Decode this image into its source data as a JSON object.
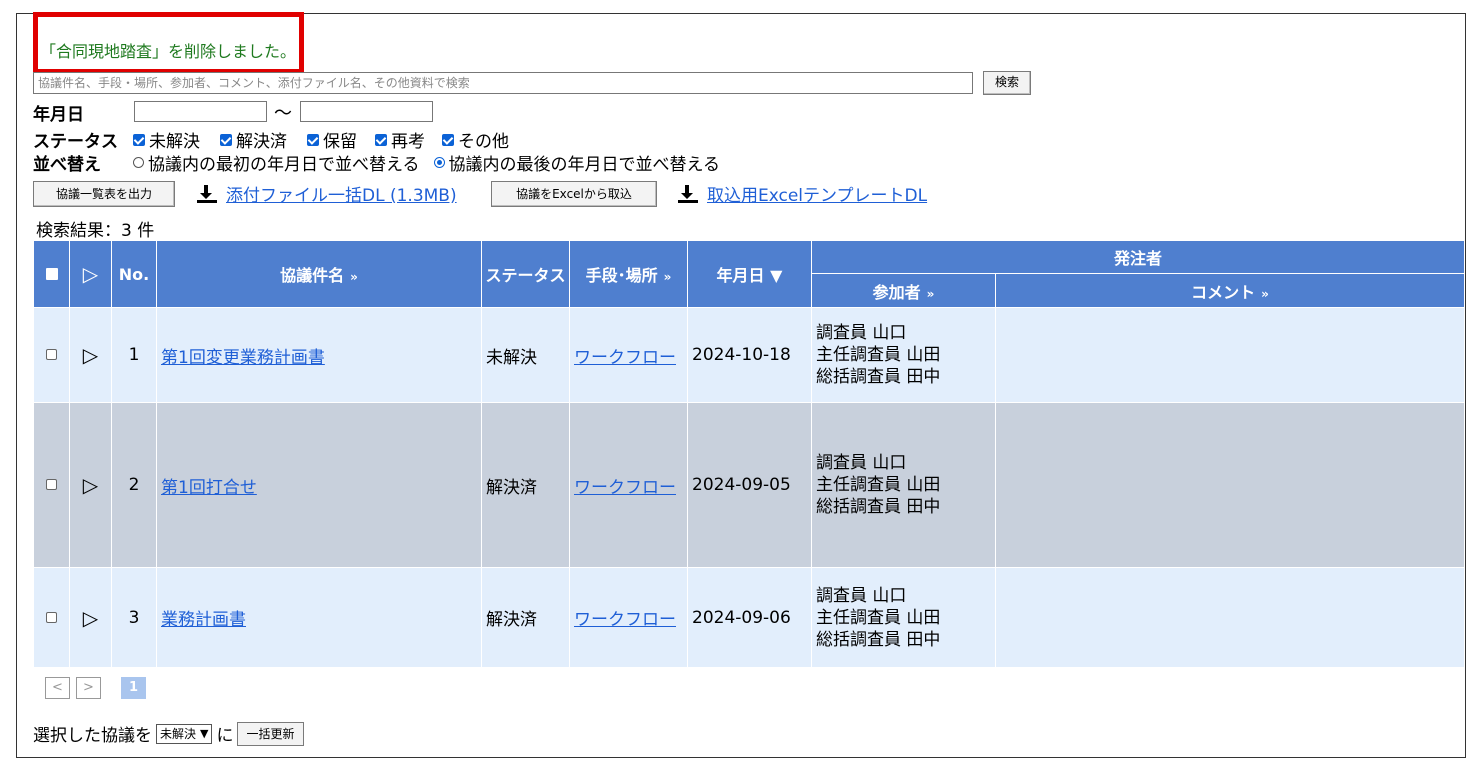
{
  "message": "「合同現地踏査」を削除しました。",
  "search": {
    "placeholder": "協議件名、手段・場所、参加者、コメント、添付ファイル名、その他資料で検索",
    "button_label": "検索"
  },
  "filters": {
    "date_label": "年月日",
    "date_sep": "～",
    "status_label": "ステータス",
    "status_options": [
      "未解決",
      "解決済",
      "保留",
      "再考",
      "その他"
    ],
    "sort_label": "並べ替え",
    "sort_options": [
      "協議内の最初の年月日で並べ替える",
      "協議内の最後の年月日で並べ替える"
    ],
    "sort_selected": 1
  },
  "actions": {
    "export_list": "協議一覧表を出力",
    "bulk_download": "添付ファイル一括DL (1.3MB)",
    "import_excel": "協議をExcelから取込",
    "template_download": "取込用ExcelテンプレートDL"
  },
  "result_count": "検索結果：3 件",
  "table": {
    "headers": {
      "no": "No.",
      "title": "協議件名",
      "status": "ステータス",
      "method": "手段･場所",
      "date": "年月日 ▼",
      "orderer": "発注者",
      "participants": "参加者",
      "comment": "コメント",
      "more": "»"
    },
    "rows": [
      {
        "no": "1",
        "title": "第1回変更業務計画書",
        "status": "未解決",
        "method": "ワークフロー",
        "date": "2024-10-18",
        "participants": [
          "調査員 山口",
          "主任調査員 山田",
          "総括調査員 田中"
        ],
        "comment": ""
      },
      {
        "no": "2",
        "title": "第1回打合せ",
        "status": "解決済",
        "method": "ワークフロー",
        "date": "2024-09-05",
        "participants": [
          "調査員 山口",
          "主任調査員 山田",
          "総括調査員 田中"
        ],
        "comment": ""
      },
      {
        "no": "3",
        "title": "業務計画書",
        "status": "解決済",
        "method": "ワークフロー",
        "date": "2024-09-06",
        "participants": [
          "調査員 山口",
          "主任調査員 山田",
          "総括調査員 田中"
        ],
        "comment": ""
      }
    ]
  },
  "pager": {
    "prev": "<",
    "next": ">",
    "current": "1"
  },
  "bulk_update": {
    "prefix": "選択した協議を",
    "selected_status": "未解決",
    "suffix": "に",
    "button": "一括更新"
  }
}
